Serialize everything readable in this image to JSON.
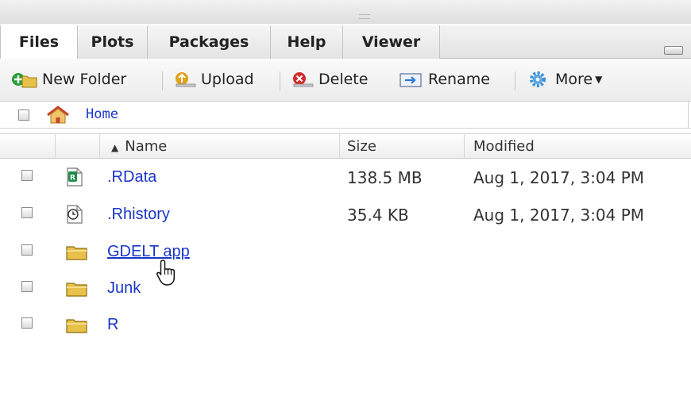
{
  "tabs": [
    {
      "label": "Files"
    },
    {
      "label": "Plots"
    },
    {
      "label": "Packages"
    },
    {
      "label": "Help"
    },
    {
      "label": "Viewer"
    }
  ],
  "toolbar": {
    "new_folder": "New Folder",
    "upload": "Upload",
    "delete": "Delete",
    "rename": "Rename",
    "more": "More"
  },
  "path": {
    "home": "Home"
  },
  "columns": {
    "name": "Name",
    "size": "Size",
    "modified": "Modified"
  },
  "files": [
    {
      "name": ".RData",
      "icon": "rdata-file-icon",
      "size": "138.5 MB",
      "modified": "Aug 1, 2017, 3:04 PM"
    },
    {
      "name": ".Rhistory",
      "icon": "history-file-icon",
      "size": "35.4 KB",
      "modified": "Aug 1, 2017, 3:04 PM"
    },
    {
      "name": "GDELT app",
      "icon": "folder-icon",
      "size": "",
      "modified": ""
    },
    {
      "name": "Junk",
      "icon": "folder-icon",
      "size": "",
      "modified": ""
    },
    {
      "name": "R",
      "icon": "folder-icon",
      "size": "",
      "modified": ""
    }
  ],
  "colors": {
    "link": "#1a35c8",
    "folder": "#e8c14a"
  }
}
